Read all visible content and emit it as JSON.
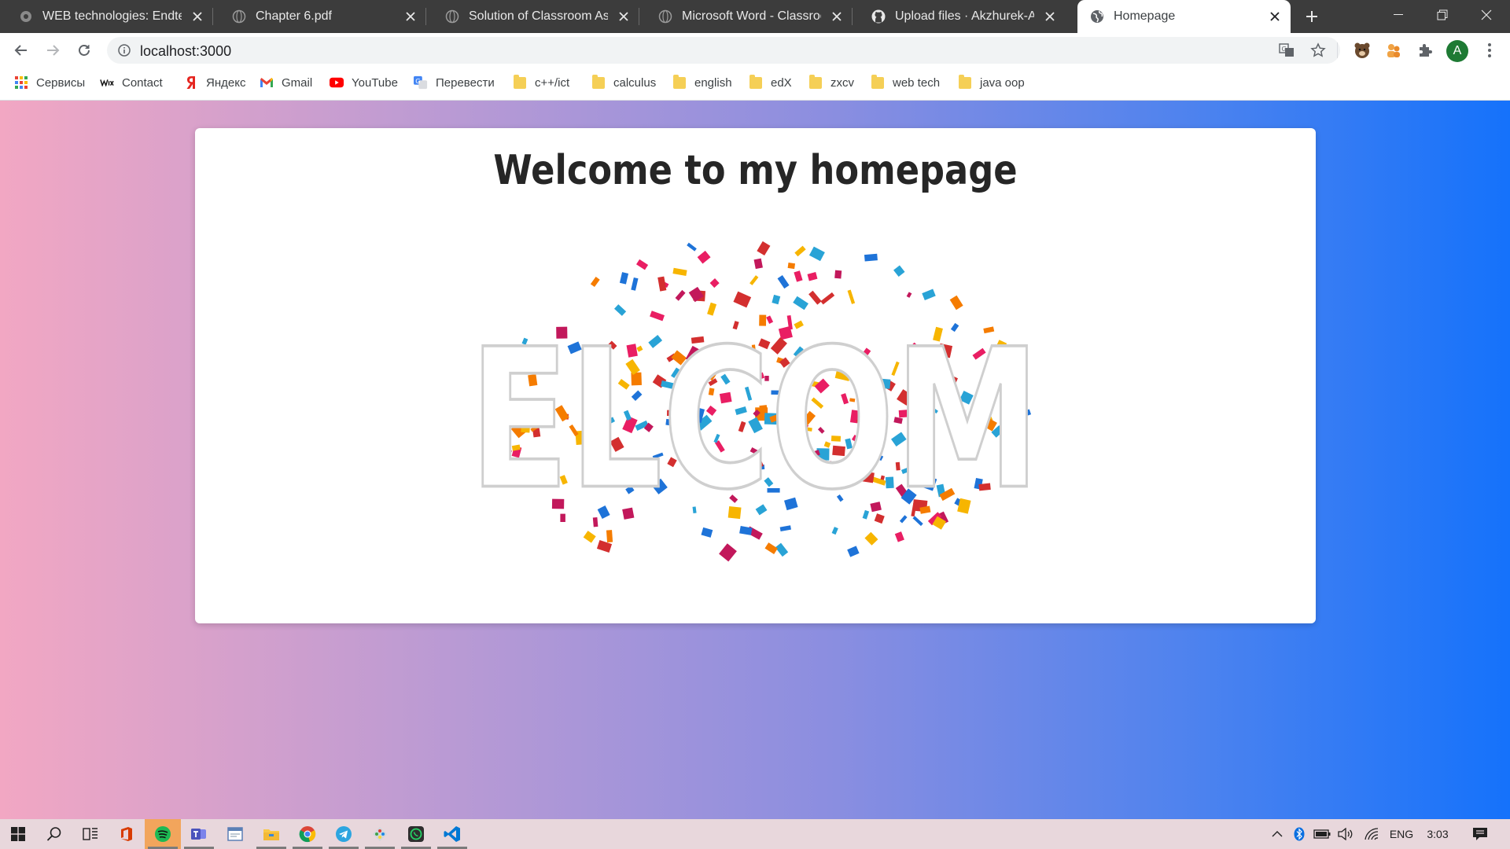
{
  "browser": {
    "tabs": [
      {
        "title": "WEB technologies: Endterm",
        "favicon": "gear-icon",
        "active": false
      },
      {
        "title": "Chapter 6.pdf",
        "favicon": "globe-icon",
        "active": false
      },
      {
        "title": "Solution of Classroom Assign",
        "favicon": "globe-icon",
        "active": false
      },
      {
        "title": "Microsoft Word - Classroom",
        "favicon": "globe-icon",
        "active": false
      },
      {
        "title": "Upload files · Akzhurek-A/En",
        "favicon": "github-icon",
        "active": false
      },
      {
        "title": "Homepage",
        "favicon": "globe-icon",
        "active": true
      }
    ],
    "address_bar": {
      "url": "localhost:3000"
    },
    "bookmarks": [
      {
        "label": "Сервисы",
        "icon": "apps-grid-icon"
      },
      {
        "label": "Contact",
        "icon": "wix-icon"
      },
      {
        "label": "Яндекс",
        "icon": "yandex-icon"
      },
      {
        "label": "Gmail",
        "icon": "gmail-icon"
      },
      {
        "label": "YouTube",
        "icon": "youtube-icon"
      },
      {
        "label": "Перевести",
        "icon": "translate-icon"
      },
      {
        "label": "c++/ict",
        "icon": "folder-icon"
      },
      {
        "label": "calculus",
        "icon": "folder-icon"
      },
      {
        "label": "english",
        "icon": "folder-icon"
      },
      {
        "label": "edX",
        "icon": "folder-icon"
      },
      {
        "label": "zxcv",
        "icon": "folder-icon"
      },
      {
        "label": "web tech",
        "icon": "folder-icon"
      },
      {
        "label": "java oop",
        "icon": "folder-icon"
      }
    ],
    "profile_initial": "A"
  },
  "page": {
    "heading": "Welcome to my homepage",
    "image_text": "WELCOME!",
    "colors": {
      "gradient_start": "#f2a7c3",
      "gradient_end": "#1572fb",
      "card": "#ffffff",
      "heading": "#262626"
    }
  },
  "taskbar": {
    "language": "ENG",
    "time": "3:03"
  }
}
